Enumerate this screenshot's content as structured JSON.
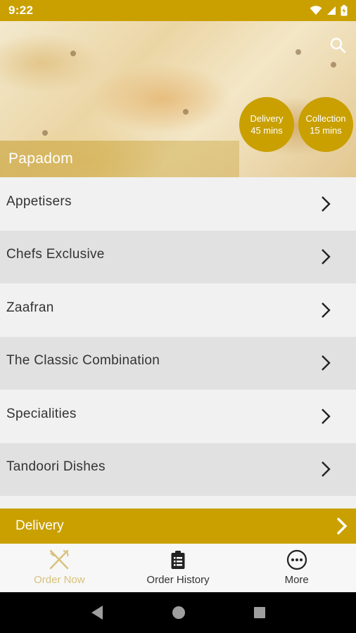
{
  "status_bar": {
    "time": "9:22"
  },
  "hero": {
    "restaurant_name": "Papadom"
  },
  "badges": {
    "delivery": {
      "title": "Delivery",
      "time": "45 mins"
    },
    "collection": {
      "title": "Collection",
      "time": "15 mins"
    }
  },
  "menu": {
    "items": [
      {
        "label": "Appetisers"
      },
      {
        "label": "Chefs Exclusive"
      },
      {
        "label": "Zaafran"
      },
      {
        "label": "The Classic Combination"
      },
      {
        "label": "Specialities"
      },
      {
        "label": "Tandoori Dishes"
      }
    ]
  },
  "delivery_bar": {
    "label": "Delivery"
  },
  "bottom_nav": {
    "tabs": [
      {
        "label": "Order Now",
        "icon": "fork-knife-icon",
        "active": true
      },
      {
        "label": "Order History",
        "icon": "clipboard-icon",
        "active": false
      },
      {
        "label": "More",
        "icon": "more-dots-icon",
        "active": false
      }
    ]
  },
  "colors": {
    "accent": "#c9a000",
    "active_tab": "#d8c17a"
  }
}
